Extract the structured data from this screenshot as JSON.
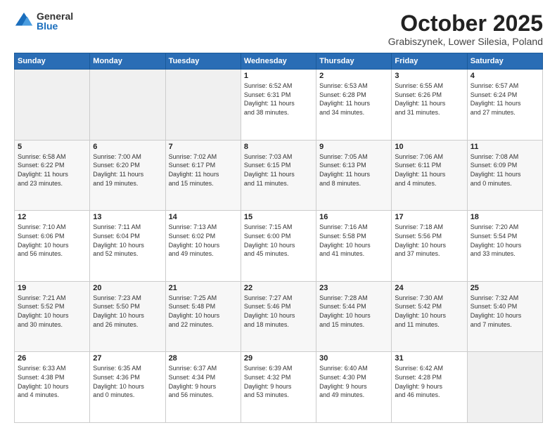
{
  "logo": {
    "general": "General",
    "blue": "Blue"
  },
  "title": {
    "month": "October 2025",
    "location": "Grabiszynek, Lower Silesia, Poland"
  },
  "days_of_week": [
    "Sunday",
    "Monday",
    "Tuesday",
    "Wednesday",
    "Thursday",
    "Friday",
    "Saturday"
  ],
  "weeks": [
    [
      {
        "day": "",
        "info": ""
      },
      {
        "day": "",
        "info": ""
      },
      {
        "day": "",
        "info": ""
      },
      {
        "day": "1",
        "info": "Sunrise: 6:52 AM\nSunset: 6:31 PM\nDaylight: 11 hours\nand 38 minutes."
      },
      {
        "day": "2",
        "info": "Sunrise: 6:53 AM\nSunset: 6:28 PM\nDaylight: 11 hours\nand 34 minutes."
      },
      {
        "day": "3",
        "info": "Sunrise: 6:55 AM\nSunset: 6:26 PM\nDaylight: 11 hours\nand 31 minutes."
      },
      {
        "day": "4",
        "info": "Sunrise: 6:57 AM\nSunset: 6:24 PM\nDaylight: 11 hours\nand 27 minutes."
      }
    ],
    [
      {
        "day": "5",
        "info": "Sunrise: 6:58 AM\nSunset: 6:22 PM\nDaylight: 11 hours\nand 23 minutes."
      },
      {
        "day": "6",
        "info": "Sunrise: 7:00 AM\nSunset: 6:20 PM\nDaylight: 11 hours\nand 19 minutes."
      },
      {
        "day": "7",
        "info": "Sunrise: 7:02 AM\nSunset: 6:17 PM\nDaylight: 11 hours\nand 15 minutes."
      },
      {
        "day": "8",
        "info": "Sunrise: 7:03 AM\nSunset: 6:15 PM\nDaylight: 11 hours\nand 11 minutes."
      },
      {
        "day": "9",
        "info": "Sunrise: 7:05 AM\nSunset: 6:13 PM\nDaylight: 11 hours\nand 8 minutes."
      },
      {
        "day": "10",
        "info": "Sunrise: 7:06 AM\nSunset: 6:11 PM\nDaylight: 11 hours\nand 4 minutes."
      },
      {
        "day": "11",
        "info": "Sunrise: 7:08 AM\nSunset: 6:09 PM\nDaylight: 11 hours\nand 0 minutes."
      }
    ],
    [
      {
        "day": "12",
        "info": "Sunrise: 7:10 AM\nSunset: 6:06 PM\nDaylight: 10 hours\nand 56 minutes."
      },
      {
        "day": "13",
        "info": "Sunrise: 7:11 AM\nSunset: 6:04 PM\nDaylight: 10 hours\nand 52 minutes."
      },
      {
        "day": "14",
        "info": "Sunrise: 7:13 AM\nSunset: 6:02 PM\nDaylight: 10 hours\nand 49 minutes."
      },
      {
        "day": "15",
        "info": "Sunrise: 7:15 AM\nSunset: 6:00 PM\nDaylight: 10 hours\nand 45 minutes."
      },
      {
        "day": "16",
        "info": "Sunrise: 7:16 AM\nSunset: 5:58 PM\nDaylight: 10 hours\nand 41 minutes."
      },
      {
        "day": "17",
        "info": "Sunrise: 7:18 AM\nSunset: 5:56 PM\nDaylight: 10 hours\nand 37 minutes."
      },
      {
        "day": "18",
        "info": "Sunrise: 7:20 AM\nSunset: 5:54 PM\nDaylight: 10 hours\nand 33 minutes."
      }
    ],
    [
      {
        "day": "19",
        "info": "Sunrise: 7:21 AM\nSunset: 5:52 PM\nDaylight: 10 hours\nand 30 minutes."
      },
      {
        "day": "20",
        "info": "Sunrise: 7:23 AM\nSunset: 5:50 PM\nDaylight: 10 hours\nand 26 minutes."
      },
      {
        "day": "21",
        "info": "Sunrise: 7:25 AM\nSunset: 5:48 PM\nDaylight: 10 hours\nand 22 minutes."
      },
      {
        "day": "22",
        "info": "Sunrise: 7:27 AM\nSunset: 5:46 PM\nDaylight: 10 hours\nand 18 minutes."
      },
      {
        "day": "23",
        "info": "Sunrise: 7:28 AM\nSunset: 5:44 PM\nDaylight: 10 hours\nand 15 minutes."
      },
      {
        "day": "24",
        "info": "Sunrise: 7:30 AM\nSunset: 5:42 PM\nDaylight: 10 hours\nand 11 minutes."
      },
      {
        "day": "25",
        "info": "Sunrise: 7:32 AM\nSunset: 5:40 PM\nDaylight: 10 hours\nand 7 minutes."
      }
    ],
    [
      {
        "day": "26",
        "info": "Sunrise: 6:33 AM\nSunset: 4:38 PM\nDaylight: 10 hours\nand 4 minutes."
      },
      {
        "day": "27",
        "info": "Sunrise: 6:35 AM\nSunset: 4:36 PM\nDaylight: 10 hours\nand 0 minutes."
      },
      {
        "day": "28",
        "info": "Sunrise: 6:37 AM\nSunset: 4:34 PM\nDaylight: 9 hours\nand 56 minutes."
      },
      {
        "day": "29",
        "info": "Sunrise: 6:39 AM\nSunset: 4:32 PM\nDaylight: 9 hours\nand 53 minutes."
      },
      {
        "day": "30",
        "info": "Sunrise: 6:40 AM\nSunset: 4:30 PM\nDaylight: 9 hours\nand 49 minutes."
      },
      {
        "day": "31",
        "info": "Sunrise: 6:42 AM\nSunset: 4:28 PM\nDaylight: 9 hours\nand 46 minutes."
      },
      {
        "day": "",
        "info": ""
      }
    ]
  ]
}
